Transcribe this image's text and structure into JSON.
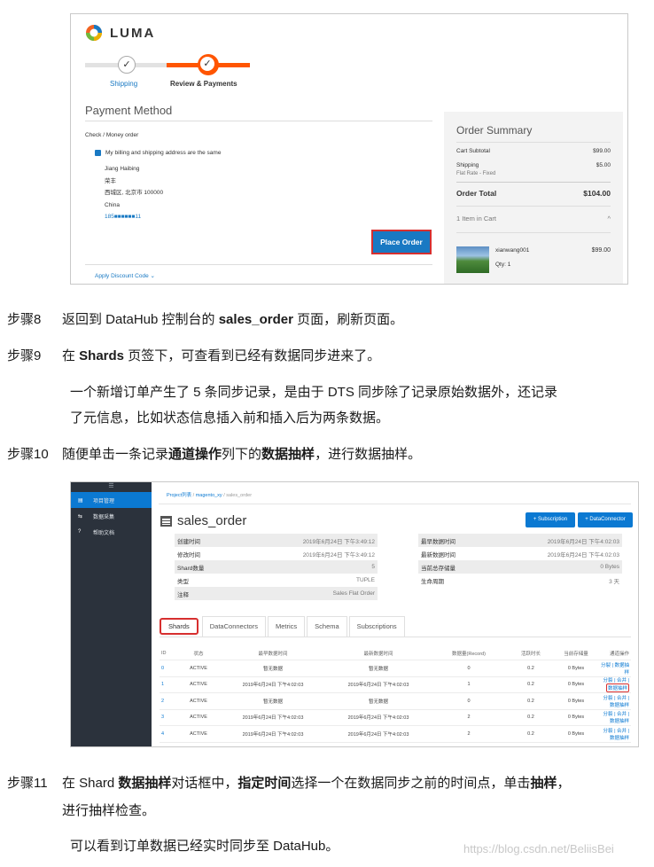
{
  "shot1": {
    "logo_text": "LUMA",
    "progress": {
      "step1_label": "Shipping",
      "step2_label": "Review & Payments",
      "check": "✓"
    },
    "payment_title": "Payment Method",
    "method_label": "Check / Money order",
    "same_address_label": "My billing and shipping address are the same",
    "address": {
      "name": "Jiang Haibing",
      "line2": "荣丰",
      "city": "西城区, 北京市 100000",
      "country": "China",
      "phone": "185■■■■■■11"
    },
    "place_order_label": "Place Order",
    "discount_label": "Apply Discount Code",
    "summary": {
      "title": "Order Summary",
      "subtotal_label": "Cart Subtotal",
      "subtotal_value": "$99.00",
      "shipping_label": "Shipping",
      "shipping_value": "$5.00",
      "shipping_method": "Flat Rate - Fixed",
      "total_label": "Order Total",
      "total_value": "$104.00",
      "items_label": "1 Item in Cart",
      "chevron": "^",
      "item_name": "xianwang001",
      "item_qty": "Qty: 1",
      "item_price": "$99.00"
    }
  },
  "steps": {
    "s8_num": "步骤8",
    "s8_a": "返回到 DataHub 控制台的 ",
    "s8_b": "sales_order",
    "s8_c": " 页面，刷新页面。",
    "s9_num": "步骤9",
    "s9_a": "在 ",
    "s9_b": "Shards",
    "s9_c": " 页签下，可查看到已经有数据同步进来了。",
    "s9_note1": "一个新增订单产生了 5 条同步记录，是由于 DTS 同步除了记录原始数据外，还记录",
    "s9_note2": "了元信息，比如状态信息插入前和插入后为两条数据。",
    "s10_num": "步骤10",
    "s10_a": "随便单击一条记录",
    "s10_b": "通道操作",
    "s10_c": "列下的",
    "s10_d": "数据抽样",
    "s10_e": "，进行数据抽样。",
    "s11_num": "步骤11",
    "s11_a": "在 Shard ",
    "s11_b": "数据抽样",
    "s11_c": "对话框中，",
    "s11_d": "指定时间",
    "s11_e": "选择一个在数据同步之前的时间点，单击",
    "s11_f": "抽样",
    "s11_g": "，",
    "s11_line2": "进行抽样检查。",
    "final_note": "可以看到订单数据已经实时同步至 DataHub。"
  },
  "shot2": {
    "menu_toggle": "☰",
    "sidebar": [
      {
        "icon": "▤",
        "label": "项目管理"
      },
      {
        "icon": "⇆",
        "label": "数据采集"
      },
      {
        "icon": "?",
        "label": "帮助文档"
      }
    ],
    "breadcrumb": {
      "p1": "Project列表",
      "sep": " / ",
      "p2": "magento_xy",
      "p3": "sales_order"
    },
    "title": "sales_order",
    "btn_subscription": "+ Subscription",
    "btn_connector": "+ DataConnector",
    "info_left": [
      {
        "label": "创建时间",
        "value": "2019年6月24日 下午3:49:12"
      },
      {
        "label": "修改时间",
        "value": "2019年6月24日 下午3:49:12"
      },
      {
        "label": "Shard数量",
        "value": "5"
      },
      {
        "label": "类型",
        "value": "TUPLE"
      },
      {
        "label": "注释",
        "value": "Sales Flat Order"
      }
    ],
    "info_right": [
      {
        "label": "最早数据时间",
        "value": "2019年6月24日 下午4:02:03"
      },
      {
        "label": "最新数据时间",
        "value": "2019年6月24日 下午4:02:03"
      },
      {
        "label": "当前总存储量",
        "value": "0 Bytes"
      },
      {
        "label": "生命周期",
        "value": "3 天"
      }
    ],
    "tabs": [
      "Shards",
      "DataConnectors",
      "Metrics",
      "Schema",
      "Subscriptions"
    ],
    "columns": [
      "ID",
      "状态",
      "最早数据时间",
      "最新数据时间",
      "数据量(Record)",
      "活跃时长",
      "当前存储量",
      "通道操作"
    ],
    "rows": [
      {
        "id": "0",
        "status": "ACTIVE",
        "t1": "暂无数据",
        "t2": "暂无数据",
        "rec": "0",
        "ttl": "0.2",
        "size": "0 Bytes",
        "ops": "分裂 | 数据抽样"
      },
      {
        "id": "1",
        "status": "ACTIVE",
        "t1": "2019年6月24日 下午4:02:03",
        "t2": "2019年6月24日 下午4:02:03",
        "rec": "1",
        "ttl": "0.2",
        "size": "0 Bytes",
        "ops": "分裂 | 合并 | ",
        "ops_hl": "数据抽样"
      },
      {
        "id": "2",
        "status": "ACTIVE",
        "t1": "暂无数据",
        "t2": "暂无数据",
        "rec": "0",
        "ttl": "0.2",
        "size": "0 Bytes",
        "ops": "分裂 | 合并 | 数据抽样"
      },
      {
        "id": "3",
        "status": "ACTIVE",
        "t1": "2019年6月24日 下午4:02:03",
        "t2": "2019年6月24日 下午4:02:03",
        "rec": "2",
        "ttl": "0.2",
        "size": "0 Bytes",
        "ops": "分裂 | 合并 | 数据抽样"
      },
      {
        "id": "4",
        "status": "ACTIVE",
        "t1": "2019年6月24日 下午4:02:03",
        "t2": "2019年6月24日 下午4:02:03",
        "rec": "2",
        "ttl": "0.2",
        "size": "0 Bytes",
        "ops": "分裂 | 合并 | 数据抽样"
      }
    ]
  },
  "watermark": "https://blog.csdn.net/BeliisBei",
  "colors": {
    "accent_orange": "#ff5501",
    "link_blue": "#1979c3",
    "console_blue": "#0b79d2",
    "highlight_red": "#d72f2f",
    "sidebar_dark": "#2b323c"
  }
}
